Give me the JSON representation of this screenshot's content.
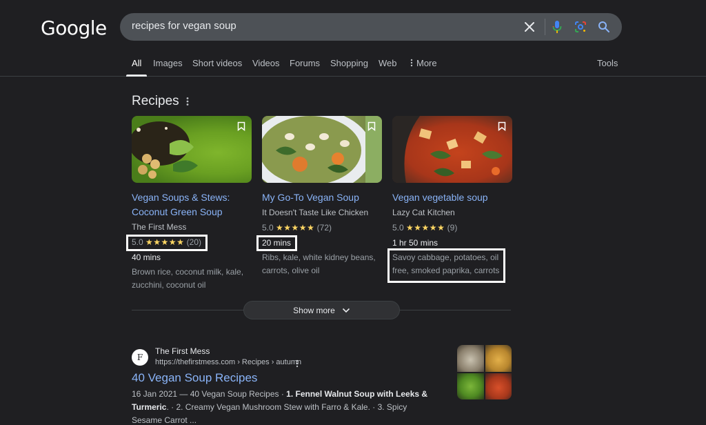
{
  "header": {
    "logo": "Google",
    "search_value": "recipes for vegan soup"
  },
  "tabs": {
    "all": "All",
    "images": "Images",
    "short_videos": "Short videos",
    "videos": "Videos",
    "forums": "Forums",
    "shopping": "Shopping",
    "web": "Web",
    "more": "More",
    "tools": "Tools"
  },
  "recipes": {
    "title": "Recipes",
    "cards": [
      {
        "title": "Vegan Soups & Stews: Coconut Green Soup",
        "source": "The First Mess",
        "rating": "5.0",
        "stars": "★★★★★",
        "reviews": "(20)",
        "time": "40 mins",
        "ingredients": "Brown rice, coconut milk, kale, zucchini, coconut oil"
      },
      {
        "title": "My Go-To Vegan Soup",
        "source": "It Doesn't Taste Like Chicken",
        "rating": "5.0",
        "stars": "★★★★★",
        "reviews": "(72)",
        "time": "20 mins",
        "ingredients": "Ribs, kale, white kidney beans, carrots, olive oil"
      },
      {
        "title": "Vegan vegetable soup",
        "source": "Lazy Cat Kitchen",
        "rating": "5.0",
        "stars": "★★★★★",
        "reviews": "(9)",
        "time": "1 hr 50 mins",
        "ingredients": "Savoy cabbage, potatoes, oil free, smoked paprika, carrots"
      }
    ],
    "show_more": "Show more"
  },
  "result": {
    "favicon_letter": "F",
    "site_name": "The First Mess",
    "url": "https://thefirstmess.com › Recipes › autumn",
    "title": "40 Vegan Soup Recipes",
    "snippet_date": "16 Jan 2021",
    "snippet_a": " — 40 Vegan Soup Recipes · ",
    "snippet_bold": "1. Fennel Walnut Soup with Leeks & Turmeric",
    "snippet_b": ". · 2. Creamy Vegan Mushroom Stew with Farro & Kale. · 3. Spicy Sesame Carrot ..."
  },
  "colors": {
    "background": "#1f1f22",
    "link": "#8ab4f8",
    "star": "#fdd663",
    "search_box": "#4d5156"
  },
  "icons": [
    "clear-icon",
    "microphone-icon",
    "lens-icon",
    "search-icon",
    "more-vert-icon",
    "bookmark-icon",
    "chevron-down-icon"
  ]
}
